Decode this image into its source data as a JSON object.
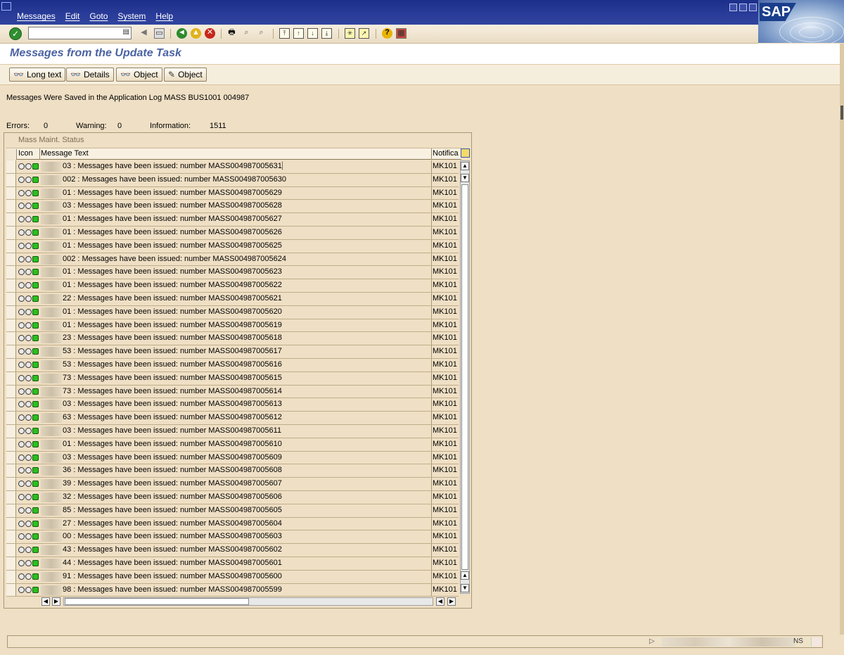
{
  "menu": {
    "items": [
      "Messages",
      "Edit",
      "Goto",
      "System",
      "Help"
    ]
  },
  "brand": {
    "logo_text": "SAP"
  },
  "toolbar": {
    "command_field_value": "",
    "icons": [
      "enter-check-icon",
      "back-icon",
      "exit-icon",
      "cancel-icon",
      "print-icon",
      "find-icon",
      "find-next-icon",
      "first-page-icon",
      "previous-page-icon",
      "next-page-icon",
      "last-page-icon",
      "create-session-icon",
      "shortcut-icon",
      "help-icon",
      "customize-layout-icon"
    ]
  },
  "screen": {
    "title": "Messages from the Update Task"
  },
  "app_toolbar": {
    "long_text_label": "Long text",
    "details_label": "Details",
    "object_view_label": "Object",
    "object_edit_label": "Object"
  },
  "info": {
    "saved_message": "Messages Were Saved in the Application Log MASS BUS1001 004987",
    "errors_label": "Errors:",
    "errors_value": "0",
    "warning_label": "Warning:",
    "warning_value": "0",
    "information_label": "Information:",
    "information_value": "1511"
  },
  "grid": {
    "title": "Mass Maint. Status",
    "columns": {
      "icon": "Icon",
      "message_text": "Message Text",
      "notification": "Notifica"
    },
    "colors": {
      "led_on": "#2bbf1f",
      "led_off": "#e8e8e8"
    },
    "rows": [
      {
        "text": "03 : Messages have been issued: number MASS004987005631",
        "notif": "MK101"
      },
      {
        "text": "002 : Messages have been issued: number MASS004987005630",
        "notif": "MK101"
      },
      {
        "text": "01 : Messages have been issued: number MASS004987005629",
        "notif": "MK101"
      },
      {
        "text": "03 : Messages have been issued: number MASS004987005628",
        "notif": "MK101"
      },
      {
        "text": "01 : Messages have been issued: number MASS004987005627",
        "notif": "MK101"
      },
      {
        "text": "01 : Messages have been issued: number MASS004987005626",
        "notif": "MK101"
      },
      {
        "text": "01 : Messages have been issued: number MASS004987005625",
        "notif": "MK101"
      },
      {
        "text": "002 : Messages have been issued: number MASS004987005624",
        "notif": "MK101"
      },
      {
        "text": "01 : Messages have been issued: number MASS004987005623",
        "notif": "MK101"
      },
      {
        "text": "01 : Messages have been issued: number MASS004987005622",
        "notif": "MK101"
      },
      {
        "text": "22 : Messages have been issued: number MASS004987005621",
        "notif": "MK101"
      },
      {
        "text": "01 : Messages have been issued: number MASS004987005620",
        "notif": "MK101"
      },
      {
        "text": "01 : Messages have been issued: number MASS004987005619",
        "notif": "MK101"
      },
      {
        "text": "23 : Messages have been issued: number MASS004987005618",
        "notif": "MK101"
      },
      {
        "text": "53 : Messages have been issued: number MASS004987005617",
        "notif": "MK101"
      },
      {
        "text": "53 : Messages have been issued: number MASS004987005616",
        "notif": "MK101"
      },
      {
        "text": "73 : Messages have been issued: number MASS004987005615",
        "notif": "MK101"
      },
      {
        "text": "73 : Messages have been issued: number MASS004987005614",
        "notif": "MK101"
      },
      {
        "text": "03 : Messages have been issued: number MASS004987005613",
        "notif": "MK101"
      },
      {
        "text": "63 : Messages have been issued: number MASS004987005612",
        "notif": "MK101"
      },
      {
        "text": "03 : Messages have been issued: number MASS004987005611",
        "notif": "MK101"
      },
      {
        "text": "01 : Messages have been issued: number MASS004987005610",
        "notif": "MK101"
      },
      {
        "text": "03 : Messages have been issued: number MASS004987005609",
        "notif": "MK101"
      },
      {
        "text": "36 : Messages have been issued: number MASS004987005608",
        "notif": "MK101"
      },
      {
        "text": "39 : Messages have been issued: number MASS004987005607",
        "notif": "MK101"
      },
      {
        "text": "32 : Messages have been issued: number MASS004987005606",
        "notif": "MK101"
      },
      {
        "text": "85 : Messages have been issued: number MASS004987005605",
        "notif": "MK101"
      },
      {
        "text": "27 : Messages have been issued: number MASS004987005604",
        "notif": "MK101"
      },
      {
        "text": "00 : Messages have been issued: number MASS004987005603",
        "notif": "MK101"
      },
      {
        "text": "43 : Messages have been issued: number MASS004987005602",
        "notif": "MK101"
      },
      {
        "text": "44 : Messages have been issued: number MASS004987005601",
        "notif": "MK101"
      },
      {
        "text": "91 : Messages have been issued: number MASS004987005600",
        "notif": "MK101"
      },
      {
        "text": "98 : Messages have been issued: number MASS004987005599",
        "notif": "MK101"
      }
    ]
  },
  "statusbar": {
    "mode_text": "NS"
  }
}
